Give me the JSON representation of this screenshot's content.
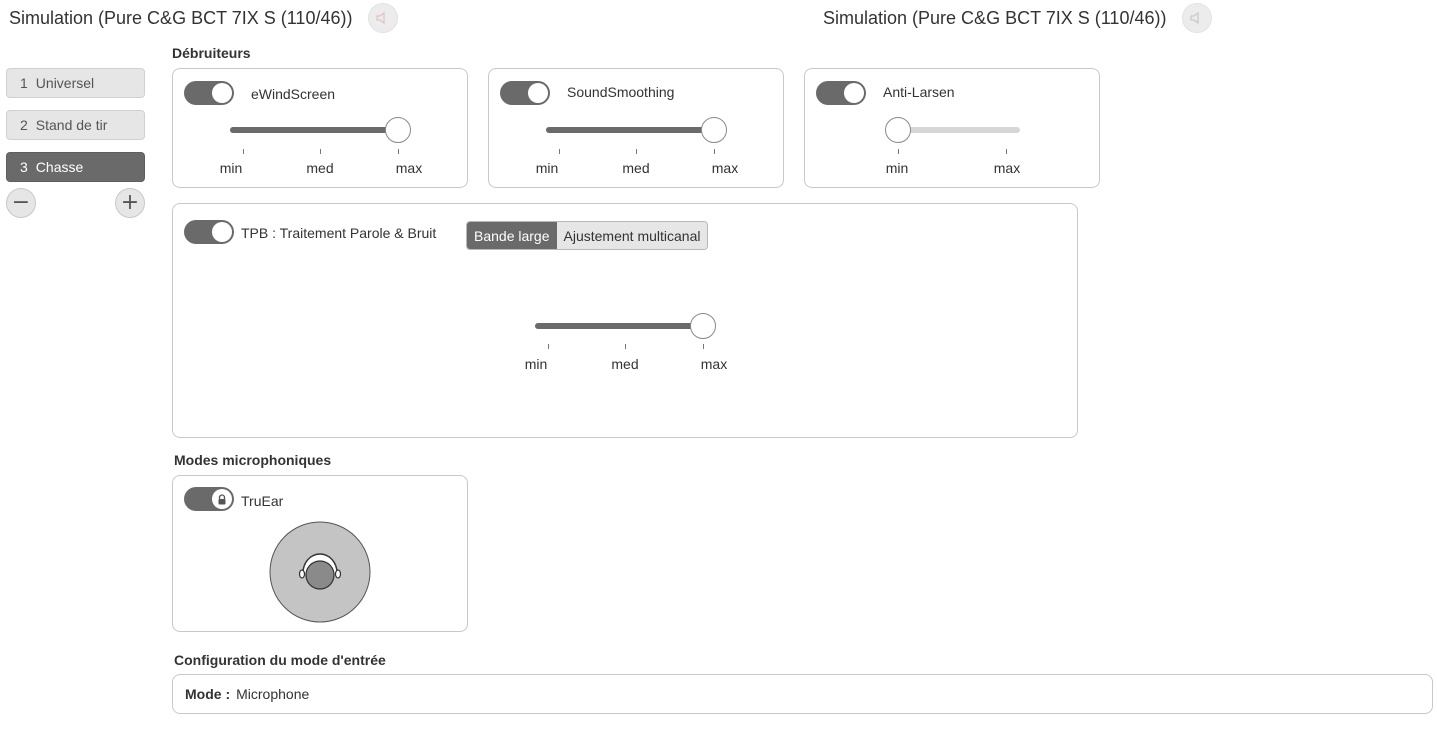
{
  "headers": [
    {
      "title": "Simulation (Pure C&G BCT 7IX S (110/46))"
    },
    {
      "title": "Simulation (Pure C&G BCT 7IX S (110/46))"
    }
  ],
  "programs": [
    {
      "number": "1",
      "label": "Universel"
    },
    {
      "number": "2",
      "label": "Stand de tir"
    },
    {
      "number": "3",
      "label": "Chasse"
    }
  ],
  "program_controls": {
    "remove": "−",
    "add": "+"
  },
  "noise_reducers": {
    "section_title": "Débruiteurs",
    "ewindscreen": {
      "label": "eWindScreen",
      "enabled": true,
      "level": 1.0,
      "ticks": [
        "min",
        "med",
        "max"
      ]
    },
    "soundsmoothing": {
      "label": "SoundSmoothing",
      "enabled": true,
      "level": 1.0,
      "ticks": [
        "min",
        "med",
        "max"
      ]
    },
    "anti_larsen": {
      "label": "Anti-Larsen",
      "enabled": true,
      "level": 0.0,
      "ticks": [
        "min",
        "max"
      ]
    },
    "tpb": {
      "label": "TPB : Traitement Parole & Bruit",
      "enabled": true,
      "level": 1.0,
      "tabs": [
        "Bande large",
        "Ajustement multicanal"
      ],
      "active_tab": "Bande large",
      "ticks": [
        "min",
        "med",
        "max"
      ]
    }
  },
  "mic_modes": {
    "section_title": "Modes microphoniques",
    "truear": {
      "label": "TruEar",
      "enabled": true,
      "locked": true
    }
  },
  "input_config": {
    "section_title": "Configuration du mode d'entrée",
    "mode_key": "Mode :",
    "mode_value": "Microphone"
  },
  "colors": {
    "active": "#6a6a6a",
    "inactive": "#e6e6e6",
    "border": "#c8c8c8"
  }
}
